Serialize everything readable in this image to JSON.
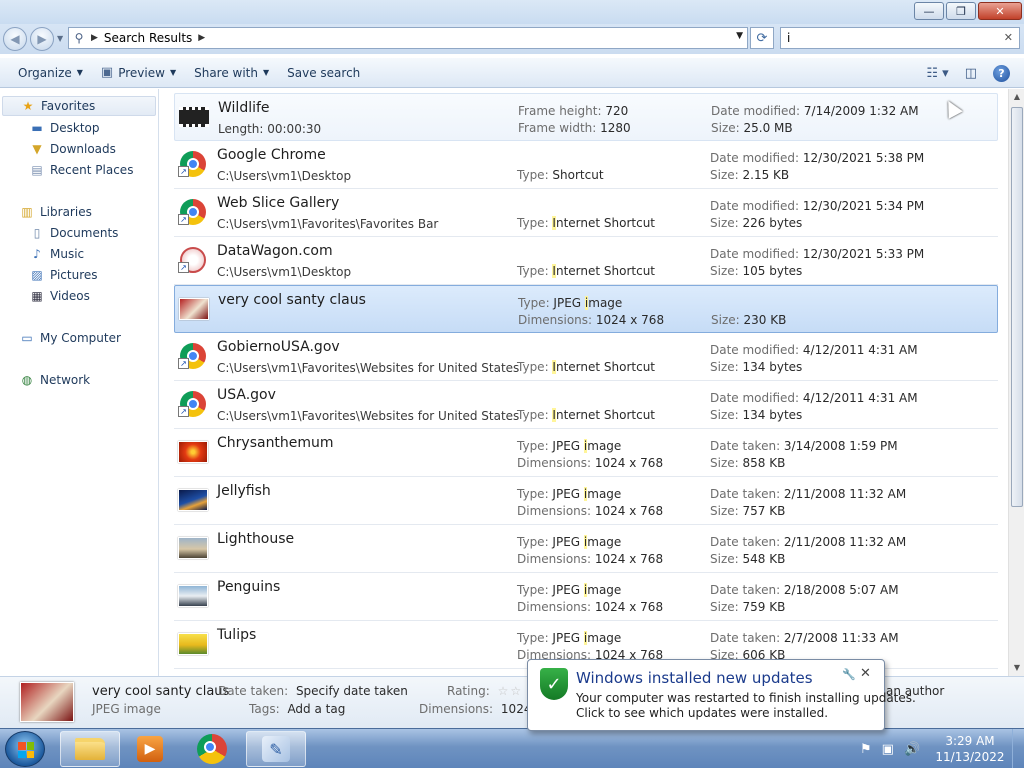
{
  "window": {
    "controls": [
      "—",
      "❐",
      "✕"
    ]
  },
  "address": {
    "location": "Search Results",
    "search_value": "i"
  },
  "toolbar": {
    "organize": "Organize",
    "preview": "Preview",
    "share_with": "Share with",
    "save_search": "Save search"
  },
  "nav": {
    "favorites": "Favorites",
    "desktop": "Desktop",
    "downloads": "Downloads",
    "recent_places": "Recent Places",
    "libraries": "Libraries",
    "documents": "Documents",
    "music": "Music",
    "pictures": "Pictures",
    "videos": "Videos",
    "my_computer": "My Computer",
    "network": "Network"
  },
  "results": [
    {
      "name": "Wildlife",
      "sub": "Length: 00:00:30",
      "mid1_label": "Frame height: ",
      "mid1_value": "720",
      "mid2_label": "Frame width: ",
      "mid2_value": "1280",
      "rt1_label": "Date modified: ",
      "rt1_value": "7/14/2009 1:32 AM",
      "rt2_label": "Size: ",
      "rt2_value": "25.0 MB"
    },
    {
      "name": "Google Chrome",
      "sub": "C:\\Users\\vm1\\Desktop",
      "mid2_label": "Type: ",
      "mid2_value": "Shortcut",
      "rt1_label": "Date modified: ",
      "rt1_value": "12/30/2021 5:38 PM",
      "rt2_label": "Size: ",
      "rt2_value": "2.15 KB"
    },
    {
      "name": "Web Slice Gallery",
      "sub": "C:\\Users\\vm1\\Favorites\\Favorites Bar",
      "mid2_label": "Type: ",
      "mid2_hl": "I",
      "mid2_value": "nternet Shortcut",
      "rt1_label": "Date modified: ",
      "rt1_value": "12/30/2021 5:34 PM",
      "rt2_label": "Size: ",
      "rt2_value": "226 bytes"
    },
    {
      "name": "DataWagon.com",
      "sub": "C:\\Users\\vm1\\Desktop",
      "mid2_label": "Type: ",
      "mid2_hl": "I",
      "mid2_value": "nternet Shortcut",
      "rt1_label": "Date modified: ",
      "rt1_value": "12/30/2021 5:33 PM",
      "rt2_label": "Size: ",
      "rt2_value": "105 bytes"
    },
    {
      "name": "very cool santy claus",
      "sub": "",
      "mid1_label": "Type: ",
      "mid1_pre": "JPEG ",
      "mid1_hl": "i",
      "mid1_value": "mage",
      "mid2_label": "Dimensions: ",
      "mid2_value": "1024 x 768",
      "rt2_label": "Size: ",
      "rt2_value": "230 KB"
    },
    {
      "name": "GobiernoUSA.gov",
      "sub": "C:\\Users\\vm1\\Favorites\\Websites for United States",
      "mid2_label": "Type: ",
      "mid2_hl": "I",
      "mid2_value": "nternet Shortcut",
      "rt1_label": "Date modified: ",
      "rt1_value": "4/12/2011 4:31 AM",
      "rt2_label": "Size: ",
      "rt2_value": "134 bytes"
    },
    {
      "name": "USA.gov",
      "sub": "C:\\Users\\vm1\\Favorites\\Websites for United States",
      "mid2_label": "Type: ",
      "mid2_hl": "I",
      "mid2_value": "nternet Shortcut",
      "rt1_label": "Date modified: ",
      "rt1_value": "4/12/2011 4:31 AM",
      "rt2_label": "Size: ",
      "rt2_value": "134 bytes"
    },
    {
      "name": "Chrysanthemum",
      "sub": "",
      "mid1_label": "Type: ",
      "mid1_pre": "JPEG ",
      "mid1_hl": "i",
      "mid1_value": "mage",
      "mid2_label": "Dimensions: ",
      "mid2_value": "1024 x 768",
      "rt1_label": "Date taken: ",
      "rt1_value": "3/14/2008 1:59 PM",
      "rt2_label": "Size: ",
      "rt2_value": "858 KB"
    },
    {
      "name": "Jellyfish",
      "sub": "",
      "mid1_label": "Type: ",
      "mid1_pre": "JPEG ",
      "mid1_hl": "i",
      "mid1_value": "mage",
      "mid2_label": "Dimensions: ",
      "mid2_value": "1024 x 768",
      "rt1_label": "Date taken: ",
      "rt1_value": "2/11/2008 11:32 AM",
      "rt2_label": "Size: ",
      "rt2_value": "757 KB"
    },
    {
      "name": "Lighthouse",
      "sub": "",
      "mid1_label": "Type: ",
      "mid1_pre": "JPEG ",
      "mid1_hl": "i",
      "mid1_value": "mage",
      "mid2_label": "Dimensions: ",
      "mid2_value": "1024 x 768",
      "rt1_label": "Date taken: ",
      "rt1_value": "2/11/2008 11:32 AM",
      "rt2_label": "Size: ",
      "rt2_value": "548 KB"
    },
    {
      "name": "Penguins",
      "sub": "",
      "mid1_label": "Type: ",
      "mid1_pre": "JPEG ",
      "mid1_hl": "i",
      "mid1_value": "mage",
      "mid2_label": "Dimensions: ",
      "mid2_value": "1024 x 768",
      "rt1_label": "Date taken: ",
      "rt1_value": "2/18/2008 5:07 AM",
      "rt2_label": "Size: ",
      "rt2_value": "759 KB"
    },
    {
      "name": "Tulips",
      "sub": "",
      "mid1_label": "Type: ",
      "mid1_pre": "JPEG ",
      "mid1_hl": "i",
      "mid1_value": "mage",
      "mid2_label": "Dimensions: ",
      "mid2_value": "1024 x 768",
      "rt1_label": "Date taken: ",
      "rt1_value": "2/7/2008 11:33 AM",
      "rt2_label": "Size: ",
      "rt2_value": "606 KB"
    }
  ],
  "details": {
    "name": "very cool santy claus",
    "type": "JPEG image",
    "date_taken_label": "Date taken:",
    "date_taken_value": "Specify date taken",
    "tags_label": "Tags:",
    "tags_value": "Add a tag",
    "rating_label": "Rating:",
    "rating_stars": "☆☆",
    "dimensions_label": "Dimensions:",
    "dimensions_value": "1024 x 7",
    "author_value": "an author"
  },
  "notification": {
    "title": "Windows installed new updates",
    "line1": "Your computer was restarted to finish installing updates.",
    "line2": "Click to see which updates were installed.",
    "close": "✕"
  },
  "taskbar": {
    "time": "3:29 AM",
    "date": "11/13/2022"
  },
  "colors": {
    "selection": "#c6dcf6",
    "highlight": "#fff59a",
    "taskbar": "#6f93c2"
  }
}
